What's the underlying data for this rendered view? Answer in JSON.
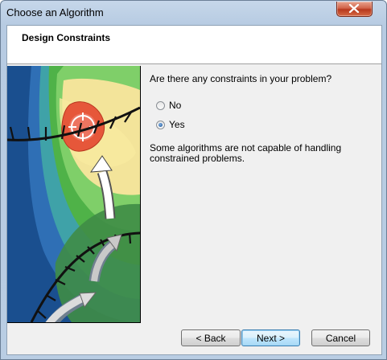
{
  "window": {
    "title": "Choose an Algorithm"
  },
  "header": {
    "title": "Design Constraints"
  },
  "main": {
    "question": "Are there any constraints in your problem?",
    "options": [
      {
        "label": "No",
        "selected": false
      },
      {
        "label": "Yes",
        "selected": true
      }
    ],
    "note": "Some algorithms are not capable of handling constrained problems."
  },
  "buttons": {
    "back": "< Back",
    "next": "Next >",
    "cancel": "Cancel"
  },
  "colors": {
    "accent": "#3c7fb1",
    "header_bg": "#ffffff",
    "panel_bg": "#f0f0f0"
  },
  "icons": {
    "close": "close-icon",
    "radio_checked": "radio-checked-icon"
  }
}
